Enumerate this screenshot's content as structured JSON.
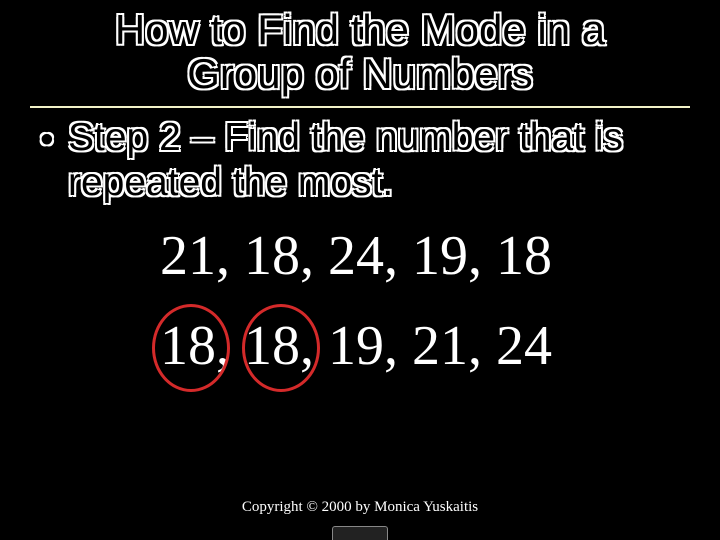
{
  "title_line1": "How to Find the Mode in a",
  "title_line2": "Group of Numbers",
  "bullet_marker": "•",
  "step_text": "Step 2 – Find the number that is repeated the most.",
  "numbers_original": "21, 18, 24, 19, 18",
  "numbers_sorted": "18, 18, 19, 21, 24",
  "copyright": "Copyright © 2000 by Monica Yuskaitis",
  "mode_circles": {
    "highlight_indices": [
      0,
      1
    ],
    "highlight_value": 18
  }
}
